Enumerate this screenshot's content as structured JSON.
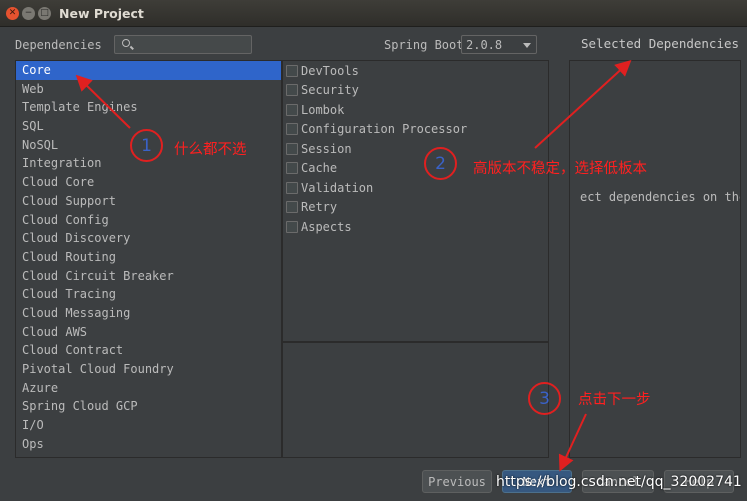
{
  "window": {
    "title": "New Project",
    "close_glyph": "✕",
    "minimize_glyph": "−",
    "maximize_glyph": "□"
  },
  "header": {
    "dependencies_label": "Dependencies",
    "search_placeholder": "",
    "spring_boot_label": "Spring Boot",
    "spring_boot_version": "2.0.8"
  },
  "categories": [
    "Core",
    "Web",
    "Template Engines",
    "SQL",
    "NoSQL",
    "Integration",
    "Cloud Core",
    "Cloud Support",
    "Cloud Config",
    "Cloud Discovery",
    "Cloud Routing",
    "Cloud Circuit Breaker",
    "Cloud Tracing",
    "Cloud Messaging",
    "Cloud AWS",
    "Cloud Contract",
    "Pivotal Cloud Foundry",
    "Azure",
    "Spring Cloud GCP",
    "I/O",
    "Ops"
  ],
  "selected_category_index": 0,
  "dependencies": [
    "DevTools",
    "Security",
    "Lombok",
    "Configuration Processor",
    "Session",
    "Cache",
    "Validation",
    "Retry",
    "Aspects"
  ],
  "selected_dependencies": {
    "title": "Selected Dependencies",
    "hint": "ect dependencies on the"
  },
  "buttons": {
    "previous": "Previous",
    "next": "Next",
    "cancel": "Cancel",
    "help": "Help"
  },
  "annotations": [
    {
      "number": "1",
      "text": "什么都不选"
    },
    {
      "number": "2",
      "text": "高版本不稳定，选择低板本"
    },
    {
      "number": "3",
      "text": "点击下一步"
    }
  ],
  "watermark": "https://blog.csdn.net/qq_32002741",
  "colors": {
    "background": "#3c3f41",
    "selection": "#2f65ca",
    "annotation_red": "#ff2020",
    "annotation_number": "#3a62c8"
  }
}
